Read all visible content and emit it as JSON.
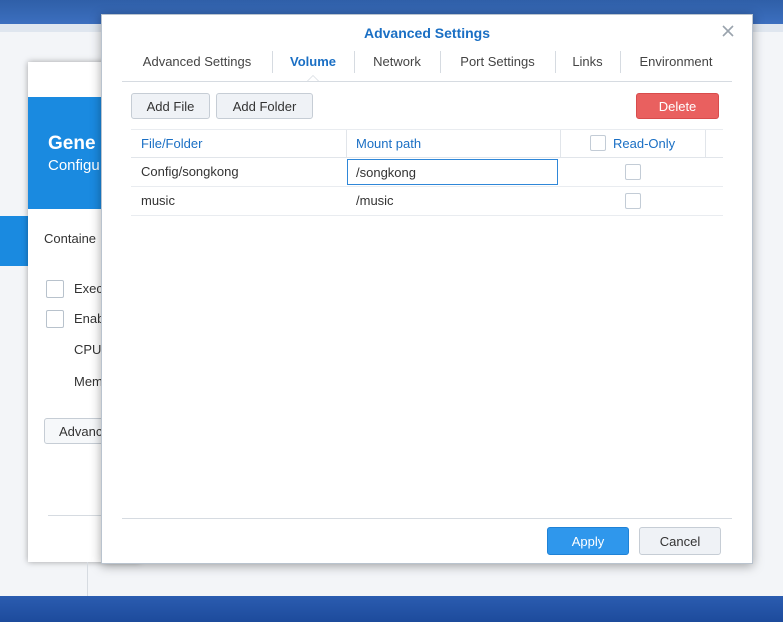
{
  "background_window": {
    "header_title": "Gene",
    "header_subtitle": "Configu",
    "container_label": "Containe",
    "check_row_1": "Exec",
    "check_row_2": "Enab",
    "cpu_label": "CPU",
    "memory_label": "Mem",
    "advanced_button": "Advanc"
  },
  "dialog": {
    "title": "Advanced Settings",
    "tabs": [
      {
        "label": "Advanced Settings",
        "active": false
      },
      {
        "label": "Volume",
        "active": true
      },
      {
        "label": "Network",
        "active": false
      },
      {
        "label": "Port Settings",
        "active": false
      },
      {
        "label": "Links",
        "active": false
      },
      {
        "label": "Environment",
        "active": false
      }
    ],
    "toolbar": {
      "add_file": "Add File",
      "add_folder": "Add Folder",
      "delete": "Delete"
    },
    "table": {
      "columns": [
        "File/Folder",
        "Mount path",
        "Read-Only"
      ],
      "rows": [
        {
          "file_folder": "Config/songkong",
          "mount_path": "/songkong",
          "read_only": false
        },
        {
          "file_folder": "music",
          "mount_path": "/music",
          "read_only": false
        }
      ]
    },
    "footer": {
      "apply": "Apply",
      "cancel": "Cancel"
    }
  },
  "colors": {
    "accent": "#1a6fc4",
    "primary_button": "#2f97ec",
    "danger_button": "#e9605f",
    "header_blue": "#1a8ae0"
  }
}
